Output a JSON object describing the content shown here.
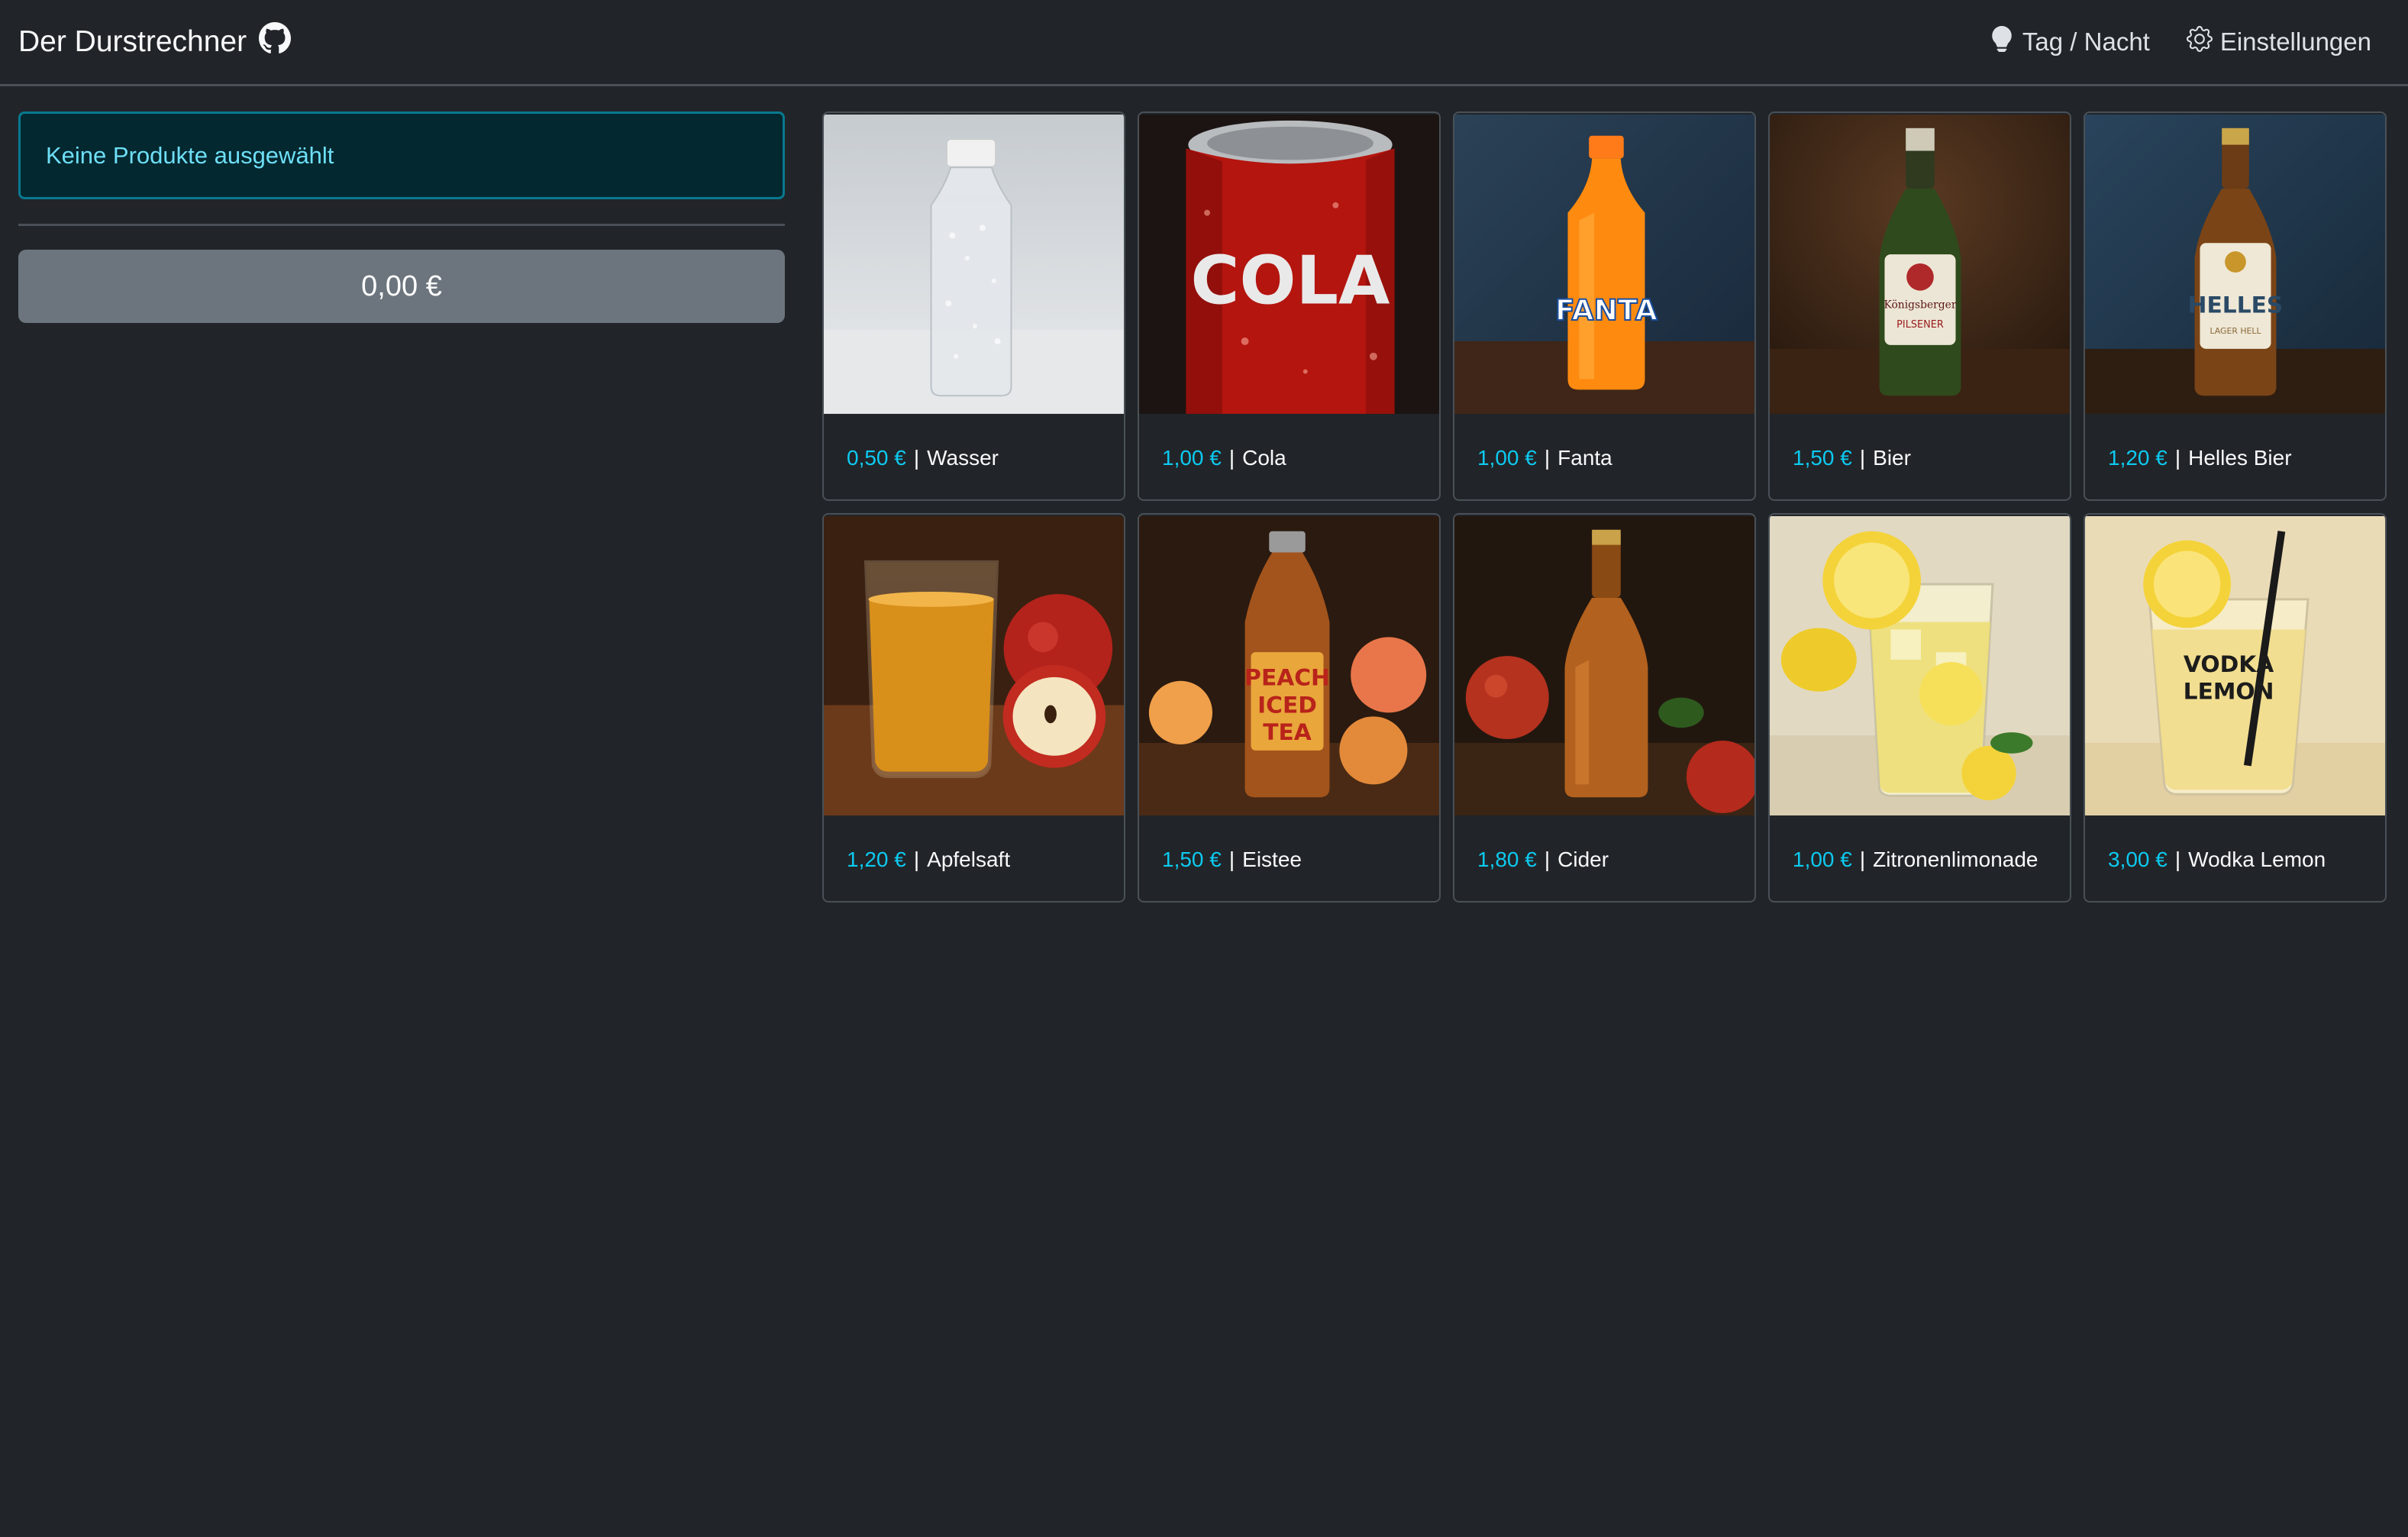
{
  "navbar": {
    "title": "Der Durstrechner",
    "github_icon": "github-icon",
    "day_night_label": "Tag / Nacht",
    "day_night_icon": "lightbulb-icon",
    "settings_label": "Einstellungen",
    "settings_icon": "gear-icon"
  },
  "sidebar": {
    "empty_message": "Keine Produkte ausgewählt",
    "total": "0,00 €"
  },
  "colors": {
    "background": "#212529",
    "price_accent": "#0dcaf0",
    "alert_text": "#6edff6",
    "total_button": "#6c757d"
  },
  "products": [
    {
      "price": "0,50 €",
      "name": "Wasser",
      "image": "water-bottle-image"
    },
    {
      "price": "1,00 €",
      "name": "Cola",
      "image": "cola-can-image",
      "image_text": "COLA"
    },
    {
      "price": "1,00 €",
      "name": "Fanta",
      "image": "fanta-bottle-image",
      "image_text": "FANTA"
    },
    {
      "price": "1,50 €",
      "name": "Bier",
      "image": "beer-bottle-image",
      "image_text": "Königsberger PILSENER"
    },
    {
      "price": "1,20 €",
      "name": "Helles Bier",
      "image": "helles-bottle-image",
      "image_text": "HELLES"
    },
    {
      "price": "1,20 €",
      "name": "Apfelsaft",
      "image": "apple-juice-image"
    },
    {
      "price": "1,50 €",
      "name": "Eistee",
      "image": "iced-tea-bottle-image",
      "image_text": "PEACH ICED TEA"
    },
    {
      "price": "1,80 €",
      "name": "Cider",
      "image": "cider-bottle-image"
    },
    {
      "price": "1,00 €",
      "name": "Zitronenlimonade",
      "image": "lemonade-glass-image"
    },
    {
      "price": "3,00 €",
      "name": "Wodka Lemon",
      "image": "vodka-lemon-glass-image",
      "image_text": "VODKA LEMON"
    }
  ]
}
